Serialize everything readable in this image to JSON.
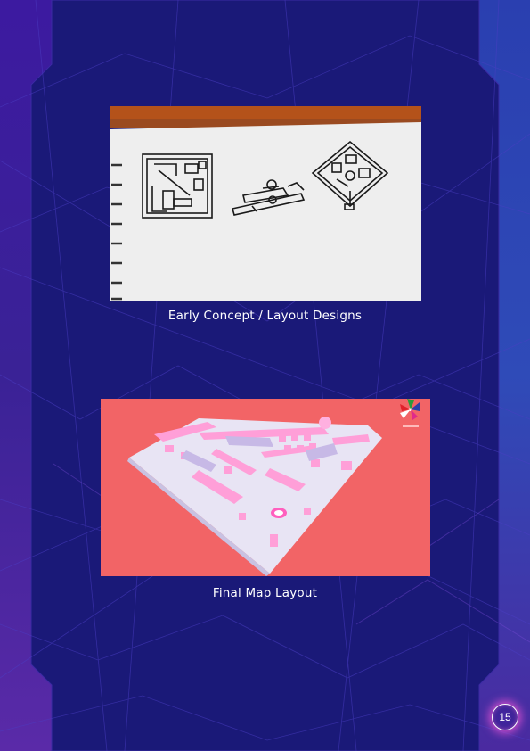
{
  "figures": [
    {
      "caption": "Early Concept / Layout Designs",
      "image": "hand-drawn-sketch-notebook"
    },
    {
      "caption": "Final Map Layout",
      "image": "3d-map-render",
      "logo": "logo-icon"
    }
  ],
  "page_number": "15",
  "colors": {
    "background": "#1b1a80",
    "frame_border": "#3a1d8f",
    "accent_glow": "#ff5adc",
    "map_background": "#f26466"
  }
}
